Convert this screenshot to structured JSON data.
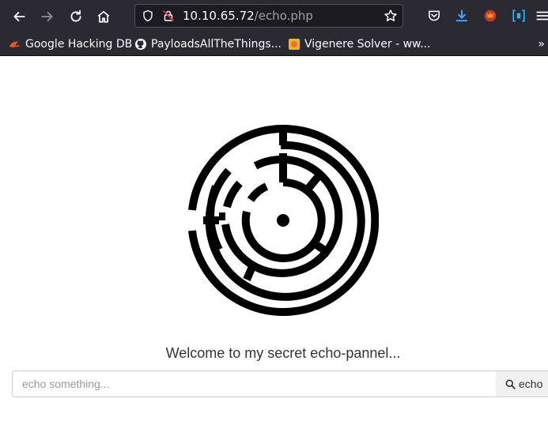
{
  "browser": {
    "url_host": "10.10.65.72",
    "url_path": "/echo.php",
    "bookmarks": [
      {
        "label": "Google Hacking DB",
        "icon": "exploit-db-icon"
      },
      {
        "label": "PayloadsAllTheThings...",
        "icon": "github-icon"
      },
      {
        "label": "Vigenere Solver - ww...",
        "icon": "dcode-icon"
      }
    ],
    "bookmarks_overflow": "»"
  },
  "page": {
    "welcome": "Welcome to my secret echo-pannel...",
    "input_placeholder": "echo something...",
    "button_label": "echo"
  },
  "colors": {
    "chrome_bg": "#2b2a33",
    "url_bg": "#1c1b22",
    "download_blue": "#54a4f9",
    "extension_blue": "#33b1ff"
  }
}
